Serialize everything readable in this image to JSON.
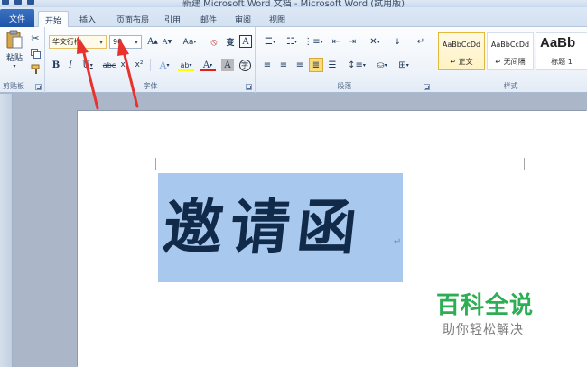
{
  "window": {
    "title": "新建 Microsoft Word 文档 - Microsoft Word (試用版)"
  },
  "tabs": {
    "file": "文件",
    "items": [
      "开始",
      "插入",
      "页面布局",
      "引用",
      "邮件",
      "审阅",
      "视图"
    ],
    "active": "开始"
  },
  "clipboard": {
    "paste_label": "粘贴",
    "group_label": "剪贴板"
  },
  "font": {
    "font_name": "华文行楷",
    "font_size": "90",
    "group_label": "字体",
    "grow_label": "A",
    "shrink_label": "A",
    "case_label": "Aa",
    "bold_label": "B",
    "italic_label": "I",
    "underline_label": "U",
    "strike_label": "abc",
    "subscript_label": "x₂",
    "superscript_label": "x²",
    "effects_label": "A",
    "highlight_label": "ab",
    "color_label": "A",
    "shading_label": "A",
    "phonetic_label": "wén",
    "char_border_label": "A",
    "enclose_label": "字",
    "highlight_color": "#ffff00",
    "font_color": "#e02020"
  },
  "paragraph": {
    "group_label": "段落"
  },
  "styles": {
    "group_label": "样式",
    "items": [
      {
        "sample": "AaBbCcDd",
        "name": "↵ 正文"
      },
      {
        "sample": "AaBbCcDd",
        "name": "↵ 无间隔"
      },
      {
        "sample": "AaBb",
        "name": "标题 1"
      }
    ]
  },
  "document": {
    "heading": "邀请函",
    "paragraph_mark": "↵"
  },
  "watermark": {
    "main": "百科全说",
    "sub": "助你轻松解决"
  },
  "colors": {
    "selection": "#a8c8ee",
    "heading_text": "#122a4a",
    "watermark_green": "#2dae55",
    "annotation_red": "#e8322e",
    "file_tab": "#2b62b5"
  }
}
